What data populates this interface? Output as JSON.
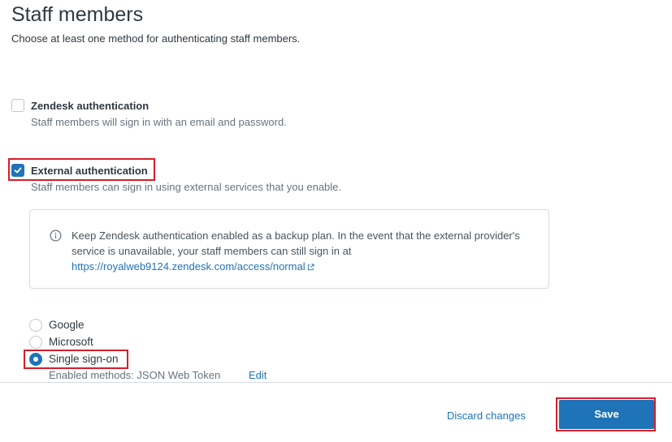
{
  "header": {
    "title": "Staff members",
    "description": "Choose at least one method for authenticating staff members."
  },
  "options": {
    "zendesk": {
      "label": "Zendesk authentication",
      "hint": "Staff members will sign in with an email and password.",
      "checked": false
    },
    "external": {
      "label": "External authentication",
      "hint": "Staff members can sign in using external services that you enable.",
      "checked": true
    }
  },
  "info": {
    "icon": "info-icon",
    "text": "Keep Zendesk authentication enabled as a backup plan. In the event that the external provider's service is unavailable, your staff members can still sign in at",
    "link": "https://royalweb9124.zendesk.com/access/normal"
  },
  "external_services": {
    "items": [
      {
        "label": "Google",
        "selected": false
      },
      {
        "label": "Microsoft",
        "selected": false
      },
      {
        "label": "Single sign-on",
        "selected": true
      }
    ],
    "sso_methods": "Enabled methods: JSON Web Token",
    "edit_label": "Edit"
  },
  "footer": {
    "discard_label": "Discard changes",
    "save_label": "Save"
  },
  "colors": {
    "accent": "#1f73b7",
    "highlight": "#d61e29"
  }
}
